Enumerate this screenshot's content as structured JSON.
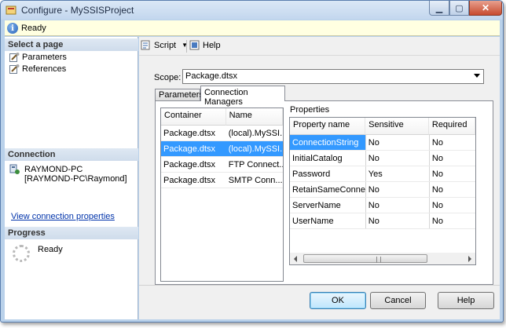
{
  "window": {
    "title": "Configure - MySSISProject"
  },
  "status": {
    "text": "Ready"
  },
  "left": {
    "select_page_header": "Select a page",
    "pages": [
      {
        "label": "Parameters",
        "icon": "wrench-page-icon"
      },
      {
        "label": "References",
        "icon": "wrench-page-icon"
      }
    ],
    "connection_header": "Connection",
    "server": "RAYMOND-PC",
    "user": "[RAYMOND-PC\\Raymond]",
    "view_link": "View connection properties",
    "progress_header": "Progress",
    "progress_text": "Ready"
  },
  "toolbar": {
    "script_label": "Script",
    "help_label": "Help"
  },
  "scope": {
    "label": "Scope:",
    "value": "Package.dtsx"
  },
  "tabs": [
    {
      "label": "Parameters"
    },
    {
      "label": "Connection Managers"
    }
  ],
  "connections": {
    "columns": [
      "Container",
      "Name"
    ],
    "rows": [
      {
        "container": "Package.dtsx",
        "name": "(local).MySSI..."
      },
      {
        "container": "Package.dtsx",
        "name": "(local).MySSI..."
      },
      {
        "container": "Package.dtsx",
        "name": "FTP Connect..."
      },
      {
        "container": "Package.dtsx",
        "name": "SMTP Conn..."
      }
    ],
    "selected_index": 1
  },
  "properties": {
    "label": "Properties",
    "columns": [
      "Property name",
      "Sensitive",
      "Required"
    ],
    "rows": [
      {
        "name": "ConnectionString",
        "sensitive": "No",
        "required": "No"
      },
      {
        "name": "InitialCatalog",
        "sensitive": "No",
        "required": "No"
      },
      {
        "name": "Password",
        "sensitive": "Yes",
        "required": "No"
      },
      {
        "name": "RetainSameConnec...",
        "sensitive": "No",
        "required": "No"
      },
      {
        "name": "ServerName",
        "sensitive": "No",
        "required": "No"
      },
      {
        "name": "UserName",
        "sensitive": "No",
        "required": "No"
      }
    ],
    "selected_index": 0
  },
  "buttons": {
    "ok": "OK",
    "cancel": "Cancel",
    "help": "Help"
  },
  "colors": {
    "selection": "#3399ff",
    "link": "#0033aa"
  }
}
